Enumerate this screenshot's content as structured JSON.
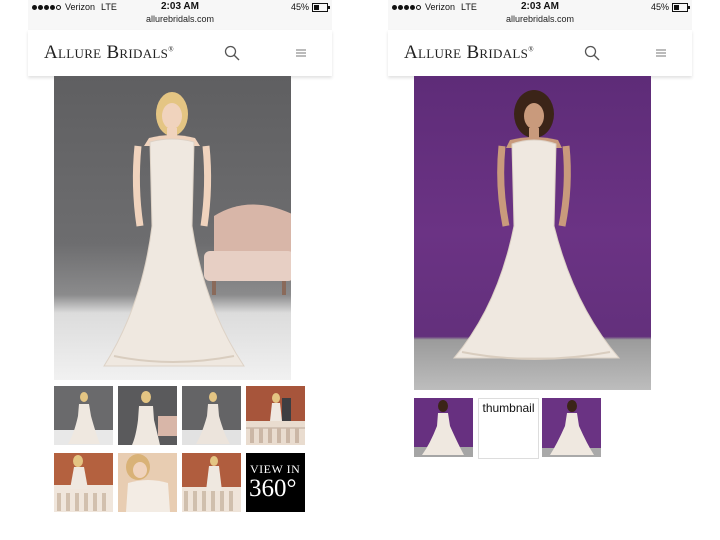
{
  "left": {
    "status": {
      "carrier": "Verizon",
      "network": "LTE",
      "time": "2:03 AM",
      "battery": "45%",
      "battery_level": 0.45,
      "url": "allurebridals.com"
    },
    "brand": "Allure Bridals",
    "brand_mark": "®",
    "view360": {
      "line1": "VIEW IN",
      "line2": "360°"
    }
  },
  "right": {
    "status": {
      "carrier": "Verizon",
      "network": "LTE",
      "time": "2:03 AM",
      "battery": "45%",
      "battery_level": 0.45,
      "url": "allurebridals.com"
    },
    "brand": "Allure Bridals",
    "brand_mark": "®",
    "thumbnail_alt": "thumbnail"
  },
  "icons": {
    "search": "search-icon",
    "menu": "hamburger-menu-icon"
  },
  "colors": {
    "left_backdrop": "#616163",
    "right_backdrop": "#673080",
    "gown": "#efe8e0"
  }
}
